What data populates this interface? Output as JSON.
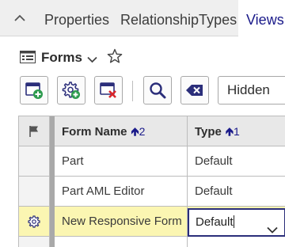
{
  "tabs": {
    "items": [
      {
        "label": "Properties"
      },
      {
        "label": "RelationshipTypes"
      },
      {
        "label": "Views"
      }
    ]
  },
  "header": {
    "title": "Forms"
  },
  "toolbar": {
    "filter_value": "Hidden"
  },
  "grid": {
    "columns": [
      {
        "label": "Form Name",
        "sort_order": "2"
      },
      {
        "label": "Type",
        "sort_order": "1"
      }
    ],
    "rows": [
      {
        "name": "Part",
        "type": "Default"
      },
      {
        "name": "Part AML Editor",
        "type": "Default"
      },
      {
        "name": "New Responsive Form",
        "type": "Default"
      }
    ]
  },
  "colors": {
    "accent": "#1a1a8a",
    "selected_row": "#fbf6b2",
    "editor_border": "#2b2e7a",
    "delete_red": "#d9252b",
    "add_green": "#2e9b4f"
  }
}
